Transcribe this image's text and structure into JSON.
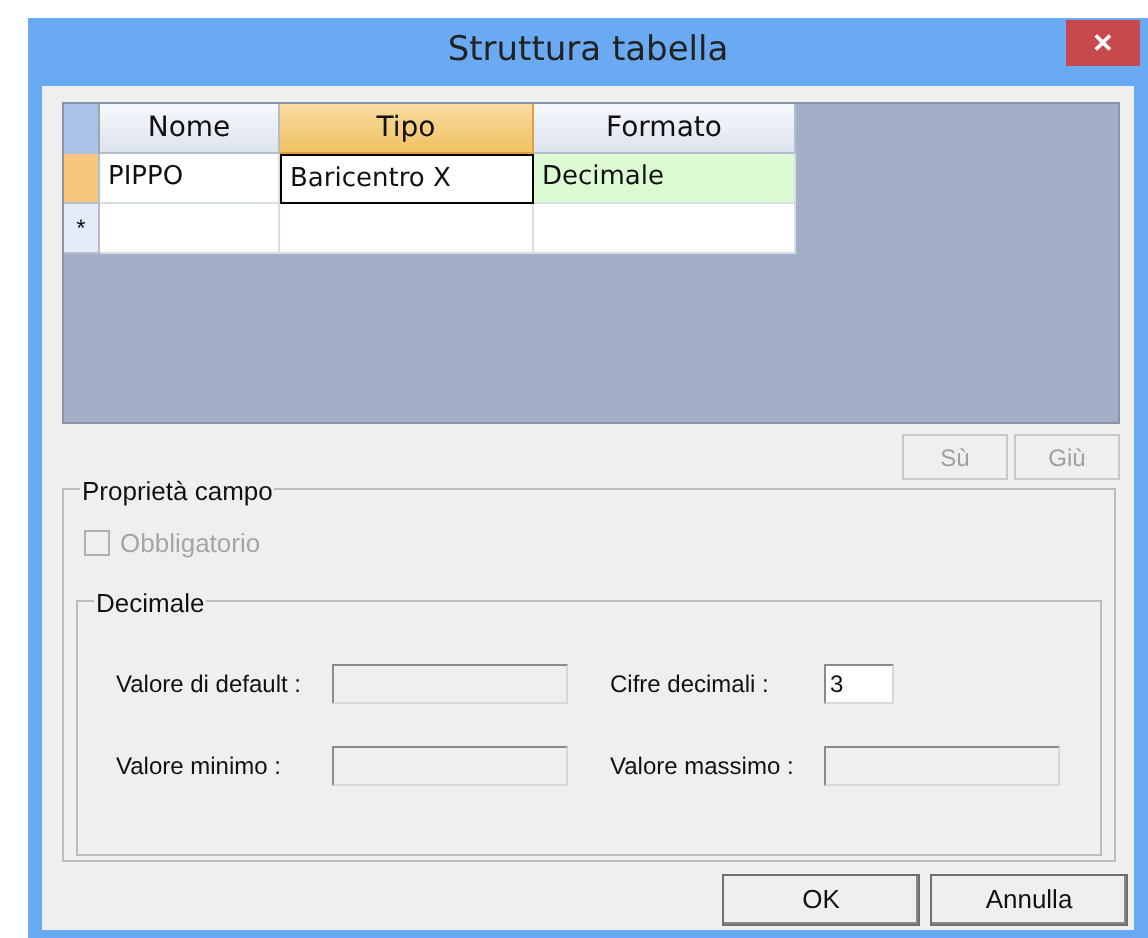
{
  "window": {
    "title": "Struttura tabella",
    "close": "✕"
  },
  "grid": {
    "columns": [
      {
        "label": "Nome",
        "selected": false
      },
      {
        "label": "Tipo",
        "selected": true
      },
      {
        "label": "Formato",
        "selected": false
      }
    ],
    "rows": [
      {
        "current": true,
        "cells": [
          {
            "text": "PIPPO",
            "focused": false,
            "highlighted": false
          },
          {
            "text": "Baricentro X",
            "focused": true,
            "highlighted": false
          },
          {
            "text": "Decimale",
            "focused": false,
            "highlighted": true
          }
        ]
      },
      {
        "marker": "*",
        "current": false,
        "cells": [
          {
            "focused": false,
            "highlighted": false
          },
          {
            "focused": false,
            "highlighted": false
          },
          {
            "focused": false,
            "highlighted": false
          }
        ]
      }
    ]
  },
  "move_buttons": [
    {
      "label": "Sù",
      "disabled": true
    },
    {
      "label": "Giù",
      "disabled": true
    }
  ],
  "field_properties": {
    "title": "Proprietà campo",
    "required": {
      "label": "Obbligatorio",
      "checked": false,
      "disabled": true
    },
    "format_group": {
      "title": "Decimale",
      "fields": [
        {
          "label": "Valore di default :",
          "disabled": true
        },
        {
          "label": "Cifre decimali :",
          "value": "3",
          "disabled": false
        },
        {
          "label": "Valore minimo :",
          "disabled": true
        },
        {
          "label": "Valore massimo :",
          "disabled": true
        }
      ]
    }
  },
  "buttons": [
    "OK",
    "Annulla"
  ]
}
